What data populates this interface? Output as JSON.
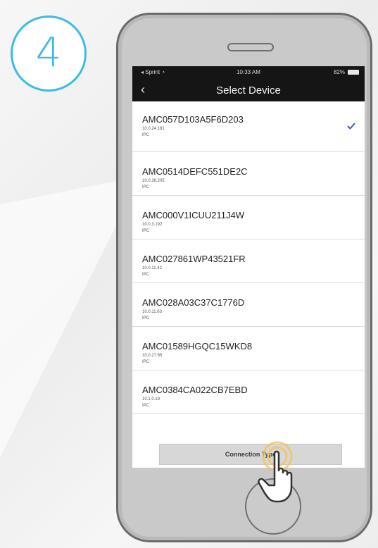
{
  "step": {
    "number": "4"
  },
  "status_bar": {
    "carrier": "Sprint",
    "time": "10:33 AM",
    "battery": "82%"
  },
  "nav": {
    "title": "Select Device",
    "back_icon": "chevron-left-icon"
  },
  "devices": [
    {
      "name": "AMC057D103A5F6D203",
      "ip": "10.0.24.181",
      "type": "IPC",
      "selected": true
    },
    {
      "name": "AMC0514DEFC551DE2C",
      "ip": "10.0.26.205",
      "type": "IPC",
      "selected": false
    },
    {
      "name": "AMC000V1ICUU211J4W",
      "ip": "10.0.3.192",
      "type": "IPC",
      "selected": false
    },
    {
      "name": "AMC027861WP43521FR",
      "ip": "10.0.11.42",
      "type": "IPC",
      "selected": false
    },
    {
      "name": "AMC028A03C37C1776D",
      "ip": "10.0.11.63",
      "type": "IPC",
      "selected": false
    },
    {
      "name": "AMC01589HGQC15WKD8",
      "ip": "10.0.27.65",
      "type": "IPC",
      "selected": false
    },
    {
      "name": "AMC0384CA022CB7EBD",
      "ip": "10.1.0.19",
      "type": "IPC",
      "selected": false
    }
  ],
  "connection_button": {
    "label": "Connection Type"
  },
  "colors": {
    "accent": "#3fbbe0",
    "checkmark": "#3b5db8",
    "tap_highlight": "#f2c35a"
  }
}
